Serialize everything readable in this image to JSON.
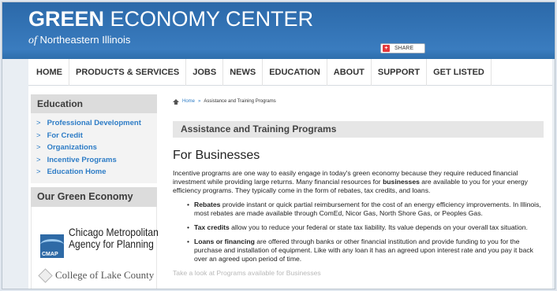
{
  "header": {
    "title_bold": "GREEN",
    "title_rest": " ECONOMY CENTER",
    "subtitle_of": "of",
    "subtitle_rest": " Northeastern Illinois",
    "share_label": "SHARE",
    "share_icon": "plus-icon"
  },
  "nav": [
    "HOME",
    "PRODUCTS & SERVICES",
    "JOBS",
    "NEWS",
    "EDUCATION",
    "ABOUT",
    "SUPPORT",
    "GET LISTED"
  ],
  "sidebar": {
    "heading": "Education",
    "chevron": ">",
    "items": [
      "Professional Development",
      "For Credit",
      "Organizations",
      "Incentive Programs",
      "Education Home"
    ],
    "partners_heading": "Our Green Economy Partners",
    "partners": {
      "cmap_line1": "Chicago Metropolitan",
      "cmap_line2": "Agency for Planning",
      "cmap_logo": "CMAP",
      "college": "College of Lake County"
    }
  },
  "main": {
    "breadcrumb_home": "Home",
    "breadcrumb_sep": "»",
    "breadcrumb_current": "Assistance and Training Programs",
    "section_title": "Assistance and Training Programs",
    "heading": "For Businesses",
    "intro_a": "Incentive programs are one way to easily engage in today's green economy because they require reduced financial investment while providing large returns.  Many financial resources for ",
    "intro_bold": "businesses",
    "intro_b": " are available to you for your energy efficiency programs. They typically come in the form of rebates, tax credits, and loans.",
    "bullets": [
      {
        "bold": "Rebates",
        "text": " provide instant or quick partial reimbursement for the cost of an energy efficiency improvements. In Illinois, most rebates are made available through ComEd, Nicor Gas, North Shore Gas, or Peoples Gas."
      },
      {
        "bold": "Tax credits",
        "text": " allow you to reduce your federal or state tax liability. Its value depends on your overall tax situation."
      },
      {
        "bold": "Loans or financing",
        "text": " are offered through banks or other financial institution and provide funding to you for the purchase and installation of equipment. Like with any loan it has an agreed upon interest rate and you pay it back over an agreed upon period of time."
      }
    ],
    "more_text": "Take a look at Programs available for Businesses"
  }
}
